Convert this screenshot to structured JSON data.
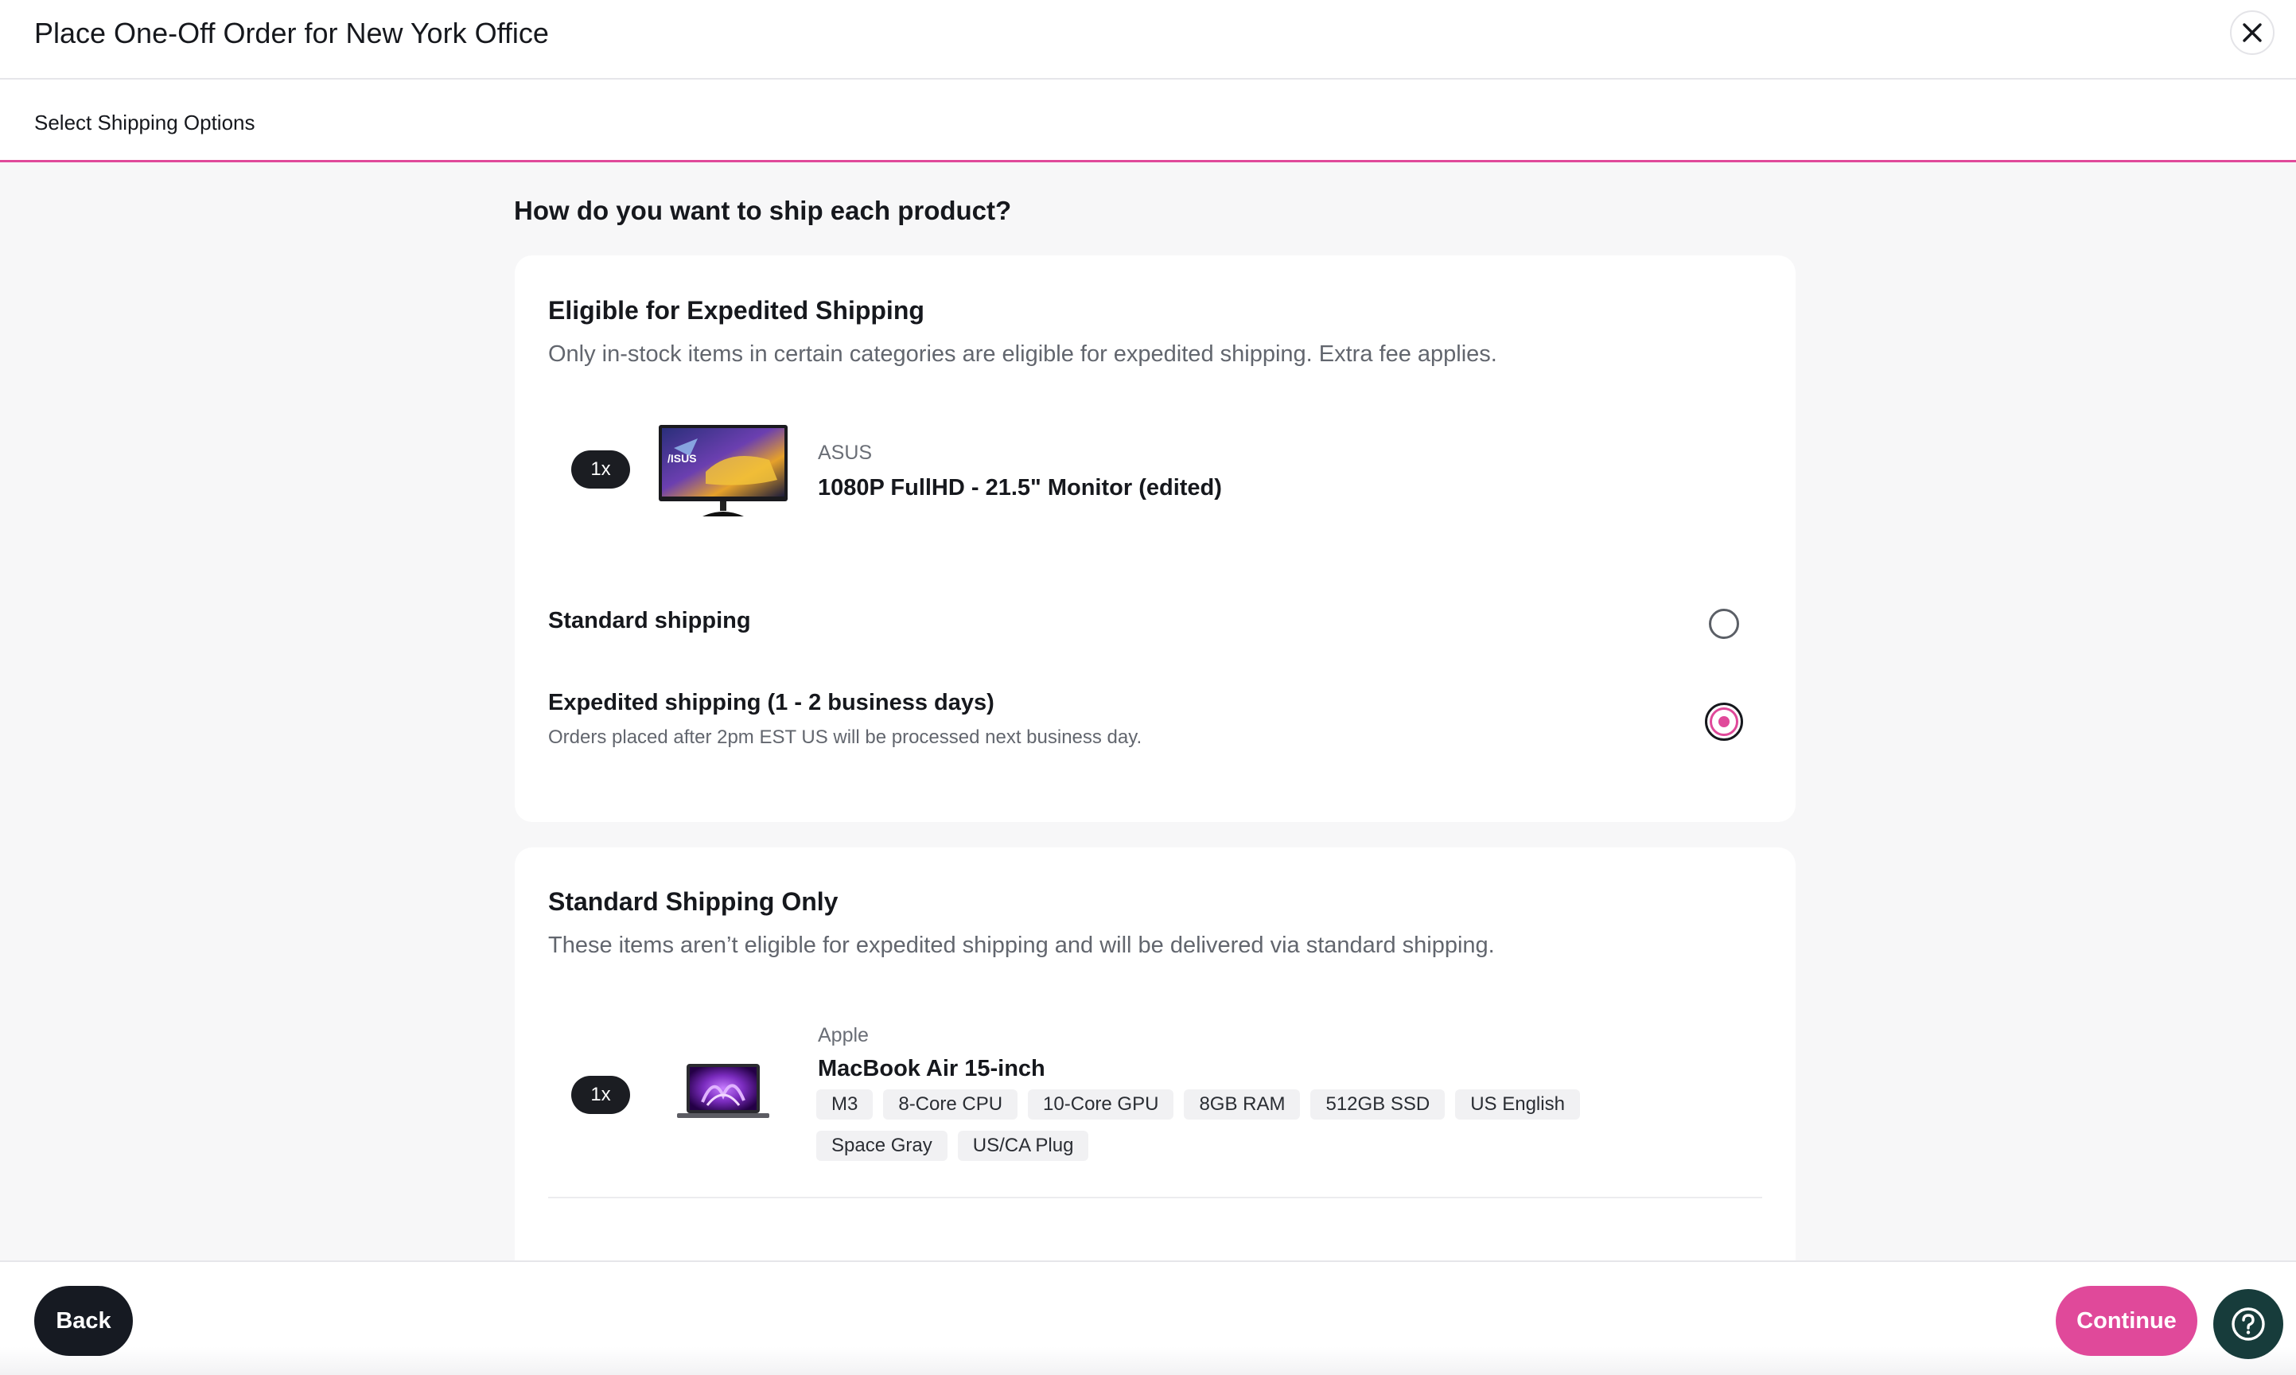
{
  "header": {
    "title": "Place One-Off Order for New York Office",
    "close_icon": "close-icon"
  },
  "stepbar": {
    "label": "Select Shipping Options",
    "accent": "#e0499a"
  },
  "main": {
    "question": "How do you want to ship each product?",
    "expedited_card": {
      "title": "Eligible for Expedited Shipping",
      "subtitle": "Only in-stock items in certain categories are eligible for expedited shipping. Extra fee applies.",
      "product": {
        "qty": "1x",
        "brand": "ASUS",
        "name": "1080P FullHD - 21.5\" Monitor (edited)",
        "image": "monitor-image"
      },
      "options": [
        {
          "label": "Standard shipping",
          "sub": "",
          "selected": false
        },
        {
          "label": "Expedited shipping (1 - 2 business days)",
          "sub": "Orders placed after 2pm EST US will be processed next business day.",
          "selected": true
        }
      ]
    },
    "standard_card": {
      "title": "Standard Shipping Only",
      "subtitle": "These items aren’t eligible for expedited shipping and will be delivered via standard shipping.",
      "product": {
        "qty": "1x",
        "brand": "Apple",
        "name": "MacBook Air 15-inch",
        "image": "laptop-image",
        "tags": [
          "M3",
          "8-Core CPU",
          "10-Core GPU",
          "8GB RAM",
          "512GB SSD",
          "US English",
          "Space Gray",
          "US/CA Plug"
        ]
      }
    }
  },
  "footer": {
    "back_label": "Back",
    "continue_label": "Continue",
    "help_icon": "help-icon"
  },
  "colors": {
    "accent": "#e0499a",
    "dark": "#161a22",
    "help": "#173c3b"
  }
}
